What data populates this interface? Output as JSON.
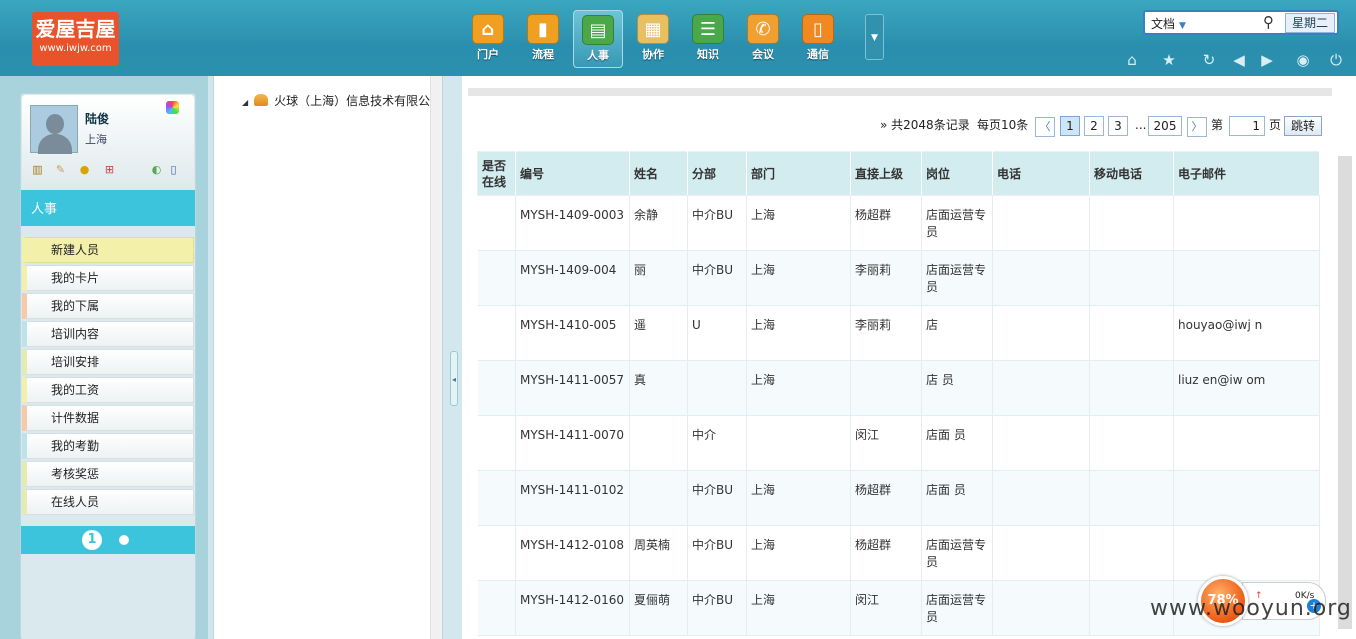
{
  "logo": {
    "cn": "爱屋吉屋",
    "en": "www.iwjw.com"
  },
  "topnav": [
    {
      "label": "门户",
      "icon": "home-icon",
      "color": "#f0a020"
    },
    {
      "label": "流程",
      "icon": "chart-icon",
      "color": "#f0a020"
    },
    {
      "label": "人事",
      "icon": "person-card-icon",
      "color": "#4aa84a"
    },
    {
      "label": "协作",
      "icon": "clipboard-icon",
      "color": "#e8c060"
    },
    {
      "label": "知识",
      "icon": "server-icon",
      "color": "#4aa84a"
    },
    {
      "label": "会议",
      "icon": "phone-icon",
      "color": "#f0a030"
    },
    {
      "label": "通信",
      "icon": "mobile-icon",
      "color": "#f08a20"
    }
  ],
  "search": {
    "scope": "文档",
    "weekday": "星期二"
  },
  "user": {
    "name": "陆俊",
    "city": "上海"
  },
  "module": {
    "title": "人事"
  },
  "menu": [
    "新建人员",
    "我的卡片",
    "我的下属",
    "培训内容",
    "培训安排",
    "我的工资",
    "计件数据",
    "我的考勤",
    "考核奖惩",
    "在线人员"
  ],
  "menu_colors": [
    "#f3f1a9",
    "#f3f1a9",
    "#f8c8a8",
    "#bde3ea",
    "#e3edb0",
    "#f3f1a9",
    "#f8c8a8",
    "#bde3ea",
    "#e3edb0",
    "#e3edb0"
  ],
  "sidebar_pager": {
    "current": "1"
  },
  "tree": {
    "root": "火球（上海）信息技术有限公"
  },
  "pager": {
    "total": "» 共2048条记录",
    "per_page": "每页10条",
    "pages": [
      "1",
      "2",
      "3"
    ],
    "ellipsis": "...",
    "last": "205",
    "go_label": "第",
    "go_value": "1",
    "page_unit": "页",
    "jump": "跳转"
  },
  "grid": {
    "columns": [
      "是否在线",
      "编号",
      "姓名",
      "分部",
      "部门",
      "直接上级",
      "岗位",
      "电话",
      "移动电话",
      "电子邮件"
    ],
    "rows": [
      [
        "",
        "MYSH-1409-0003",
        "余静",
        "中介BU",
        "上海",
        "杨超群",
        "店面运营专员",
        "",
        "",
        ""
      ],
      [
        "",
        "MYSH-1409-004",
        "丽",
        "中介BU",
        "上海",
        "李丽莉",
        "店面运营专员",
        "",
        "",
        ""
      ],
      [
        "",
        "MYSH-1410-005",
        "遥",
        "U",
        "上海",
        "李丽莉",
        "店",
        "",
        "",
        "houyao@iwj  n"
      ],
      [
        "",
        "MYSH-1411-0057",
        "真",
        "",
        "上海",
        "",
        "店 员",
        "",
        "",
        "liuz  en@iw  om"
      ],
      [
        "",
        "MYSH-1411-0070",
        "",
        "中介",
        "",
        "闵江",
        "店面 员",
        "",
        "",
        ""
      ],
      [
        "",
        "MYSH-1411-0102",
        "",
        "中介BU",
        "上海",
        "杨超群",
        "店面 员",
        "",
        "",
        ""
      ],
      [
        "",
        "MYSH-1412-0108",
        "周英楠",
        "中介BU",
        "上海",
        "杨超群",
        "店面运营专员",
        "",
        "",
        ""
      ],
      [
        "",
        "MYSH-1412-0160",
        "夏俪萌",
        "中介BU",
        "上海",
        "闵江",
        "店面运营专员",
        "",
        "",
        ""
      ]
    ]
  },
  "tray": {
    "percent": "78%",
    "up_speed": "0K/s",
    "down_speed": "0K/s"
  },
  "watermark": "www.wooyun.org"
}
